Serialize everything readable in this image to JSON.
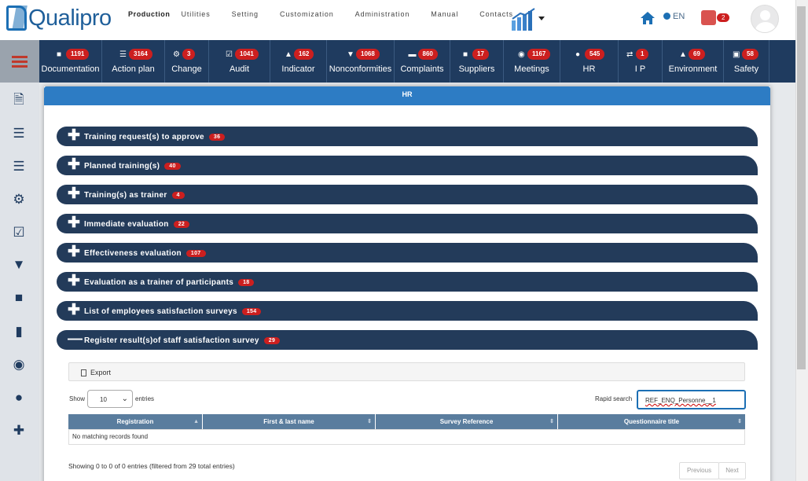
{
  "brand": {
    "logo_text": "Qualipro"
  },
  "top_nav": [
    "Production",
    "Utilities",
    "Setting",
    "Customization",
    "Administration",
    "Manual",
    "Contacts"
  ],
  "header": {
    "language": "EN",
    "notification_count": "2"
  },
  "modules": [
    {
      "label": "Documentation",
      "count": "1191"
    },
    {
      "label": "Action plan",
      "count": "3164"
    },
    {
      "label": "Change",
      "count": "3"
    },
    {
      "label": "Audit",
      "count": "1041"
    },
    {
      "label": "Indicator",
      "count": "162"
    },
    {
      "label": "Nonconformities",
      "count": "1068"
    },
    {
      "label": "Complaints",
      "count": "860"
    },
    {
      "label": "Suppliers",
      "count": "17"
    },
    {
      "label": "Meetings",
      "count": "1167"
    },
    {
      "label": "HR",
      "count": "545"
    },
    {
      "label": "I P",
      "count": "1"
    },
    {
      "label": "Environment",
      "count": "69"
    },
    {
      "label": "Safety",
      "count": "58"
    }
  ],
  "sidebar_icons": [
    "document-icon",
    "server-icon",
    "database-icon",
    "gear-icon",
    "checkbox-icon",
    "thumbs-down-icon",
    "chat-icon",
    "truck-icon",
    "dashboard-icon",
    "user-icon",
    "medkit-icon"
  ],
  "panel": {
    "title": "HR"
  },
  "accordions": [
    {
      "label": "Training request(s) to approve",
      "count": "36",
      "expanded": false
    },
    {
      "label": "Planned training(s)",
      "count": "40",
      "expanded": false
    },
    {
      "label": "Training(s) as trainer",
      "count": "4",
      "expanded": false
    },
    {
      "label": "Immediate evaluation",
      "count": "22",
      "expanded": false
    },
    {
      "label": "Effectiveness evaluation",
      "count": "107",
      "expanded": false
    },
    {
      "label": "Evaluation as a trainer of participants",
      "count": "18",
      "expanded": false
    },
    {
      "label": "List of employees satisfaction surveys",
      "count": "154",
      "expanded": false
    },
    {
      "label": "Register result(s)of staff satisfaction survey",
      "count": "29",
      "expanded": true
    }
  ],
  "table_tools": {
    "export_label": "Export",
    "show_label": "Show",
    "page_size": "10",
    "entries_label": "entries",
    "search_label": "Rapid search",
    "search_value": "REF_ENQ_Personne__1"
  },
  "table": {
    "columns": [
      "Registration",
      "First & last name",
      "Survey Reference",
      "Questionnaire title"
    ],
    "empty_message": "No matching records found",
    "info": "Showing 0 to 0 of 0 entries (filtered from 29 total entries)",
    "prev_label": "Previous",
    "next_label": "Next"
  },
  "colors": {
    "navy": "#1f3b5f",
    "accent_blue": "#2d7cc4",
    "badge_red": "#cc1f1f"
  }
}
